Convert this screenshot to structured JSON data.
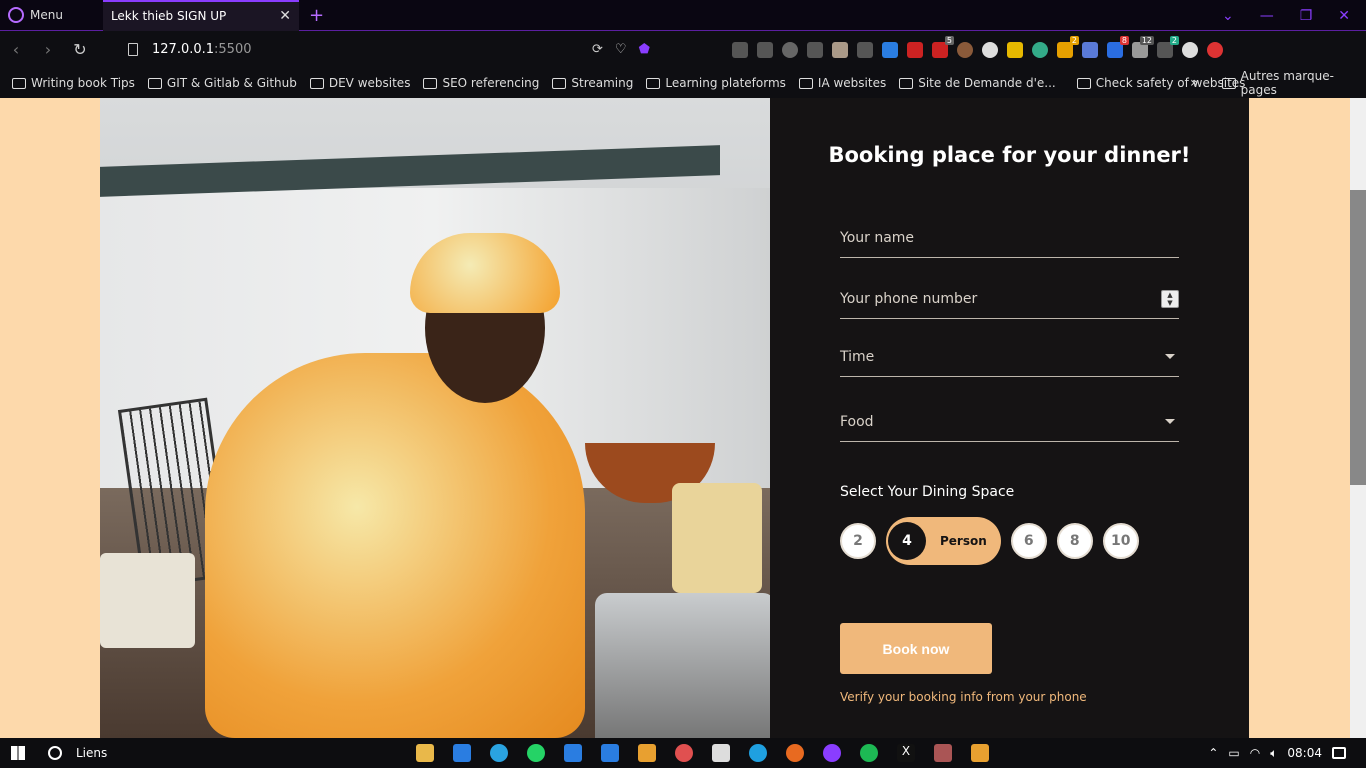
{
  "browser": {
    "menu_label": "Menu",
    "tab_title": "Lekk thieb SIGN UP",
    "tab_close": "✕",
    "new_tab": "+",
    "url_host": "127.0.0.1",
    "url_port": ":5500"
  },
  "bookmarks": {
    "items": [
      {
        "label": "Writing book Tips"
      },
      {
        "label": "GIT & Gitlab & Github"
      },
      {
        "label": "DEV websites"
      },
      {
        "label": "SEO referencing"
      },
      {
        "label": "Streaming"
      },
      {
        "label": "Learning plateforms"
      },
      {
        "label": "IA websites"
      },
      {
        "label": "Site de Demande d'e..."
      },
      {
        "label": "Check safety of websites"
      }
    ],
    "more": "»",
    "other_label": "Autres marque-pages"
  },
  "extensions": {
    "badges": [
      "5",
      "2",
      "8",
      "12",
      "2"
    ]
  },
  "booking": {
    "title": "Booking place for your dinner!",
    "name_placeholder": "Your name",
    "phone_placeholder": "Your phone number",
    "time_label": "Time",
    "food_label": "Food",
    "dining_label": "Select Your Dining Space",
    "options": [
      "2",
      "4",
      "6",
      "8",
      "10"
    ],
    "selected_option": "4",
    "selected_suffix": "Person",
    "book_button": "Book now",
    "verify_text": "Verify your booking info from your phone",
    "accent_color": "#f0b87b",
    "card_color": "#151314",
    "page_bg": "#fdd9ab"
  },
  "taskbar": {
    "search_label": "Liens",
    "clock": "08:04"
  }
}
